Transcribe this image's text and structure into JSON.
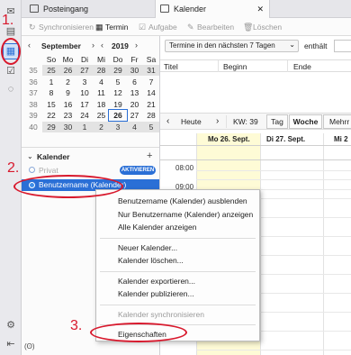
{
  "tabs": [
    {
      "label": "Posteingang",
      "icon": "inbox-icon"
    },
    {
      "label": "Kalender",
      "icon": "calendar-icon",
      "close": "✕"
    }
  ],
  "toolbar": {
    "sync": "Synchronisieren",
    "event": "Termin",
    "task": "Aufgabe",
    "edit": "Bearbeiten",
    "delete": "Löschen"
  },
  "minical": {
    "month": "September",
    "year": "2019",
    "weekday_headers": [
      "So",
      "Mo",
      "Di",
      "Mi",
      "Do",
      "Fr",
      "Sa"
    ],
    "weeks": [
      {
        "wk": "35",
        "days": [
          "25",
          "26",
          "27",
          "28",
          "29",
          "30",
          "31"
        ]
      },
      {
        "wk": "36",
        "days": [
          "1",
          "2",
          "3",
          "4",
          "5",
          "6",
          "7"
        ]
      },
      {
        "wk": "37",
        "days": [
          "8",
          "9",
          "10",
          "11",
          "12",
          "13",
          "14"
        ]
      },
      {
        "wk": "38",
        "days": [
          "15",
          "16",
          "17",
          "18",
          "19",
          "20",
          "21"
        ]
      },
      {
        "wk": "39",
        "days": [
          "22",
          "23",
          "24",
          "25",
          "26",
          "27",
          "28"
        ]
      },
      {
        "wk": "40",
        "days": [
          "29",
          "30",
          "1",
          "2",
          "3",
          "4",
          "5"
        ]
      }
    ]
  },
  "callist": {
    "header": "Kalender",
    "add": "+",
    "items": [
      {
        "label": "Privat",
        "badge": "AKTIVIEREN"
      },
      {
        "label": "Benutzername (Kalender)"
      }
    ],
    "bottom_icon": "(ʘ)"
  },
  "filter": {
    "select": "Termine in den nächsten 7 Tagen",
    "contains": "enthält"
  },
  "list_columns": [
    "Titel",
    "Beginn",
    "Ende"
  ],
  "nav": {
    "prev": "‹",
    "today": "Heute",
    "next": "›",
    "week": "KW: 39",
    "views": [
      "Tag",
      "Woche",
      "Mehrr"
    ]
  },
  "week_days": [
    "Mo 26. Sept.",
    "Di 27. Sept.",
    "Mi 2"
  ],
  "times": [
    "08:00",
    "09:00"
  ],
  "context_menu": [
    {
      "label": "Benutzername (Kalender) ausblenden",
      "enabled": true
    },
    {
      "label": "Nur Benutzername (Kalender) anzeigen",
      "enabled": true
    },
    {
      "label": "Alle Kalender anzeigen",
      "enabled": true
    },
    {
      "sep": true
    },
    {
      "label": "Neuer Kalender...",
      "enabled": true
    },
    {
      "label": "Kalender löschen...",
      "enabled": true
    },
    {
      "sep": true
    },
    {
      "label": "Kalender exportieren...",
      "enabled": true
    },
    {
      "label": "Kalender publizieren...",
      "enabled": true
    },
    {
      "sep": true
    },
    {
      "label": "Kalender synchronisieren",
      "enabled": false
    },
    {
      "sep": true
    },
    {
      "label": "Eigenschaften",
      "enabled": true
    }
  ],
  "annotations": [
    "1.",
    "2.",
    "3."
  ],
  "colors": {
    "accent": "#2a6fd6",
    "annotation": "#d8192d",
    "today_column": "#fefbd6"
  }
}
